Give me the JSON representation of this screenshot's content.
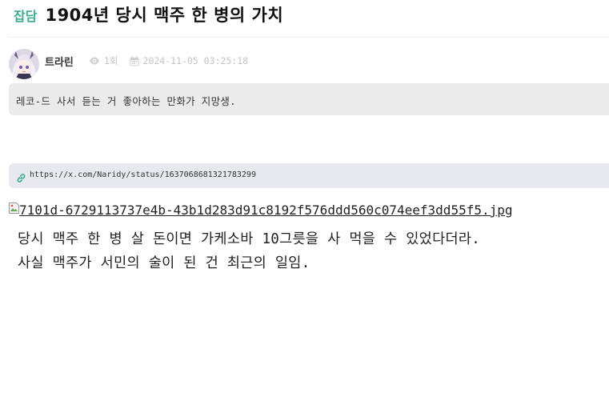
{
  "post": {
    "category": "잡담",
    "title": "1904년 당시 맥주 한 병의 가치"
  },
  "author": {
    "name": "트라린",
    "views": "1회",
    "date": "2024-11-05 03:25:18"
  },
  "quote": "레코-드 사서 듣는 거 좋아하는 만화가 지망생.",
  "link": {
    "url": "https://x.com/Naridy/status/1637068681321783299"
  },
  "image": {
    "alt": "7101d-6729113737e4b-43b1d283d91c8192f576ddd560c074eef3dd55f5.jpg"
  },
  "body": {
    "line1": "당시 맥주 한 병 살 돈이면 가케소바 10그릇을 사 먹을 수 있었다더라.",
    "line2": "사실 맥주가 서민의 술이 된 건 최근의 일임."
  },
  "icons": {
    "views": "eye-icon",
    "date": "calendar-icon",
    "link": "link-icon",
    "image": "broken-image-icon"
  },
  "colors": {
    "category": "#3cae8d",
    "link_icon": "#3cae8d",
    "meta": "#c3c3c3"
  }
}
